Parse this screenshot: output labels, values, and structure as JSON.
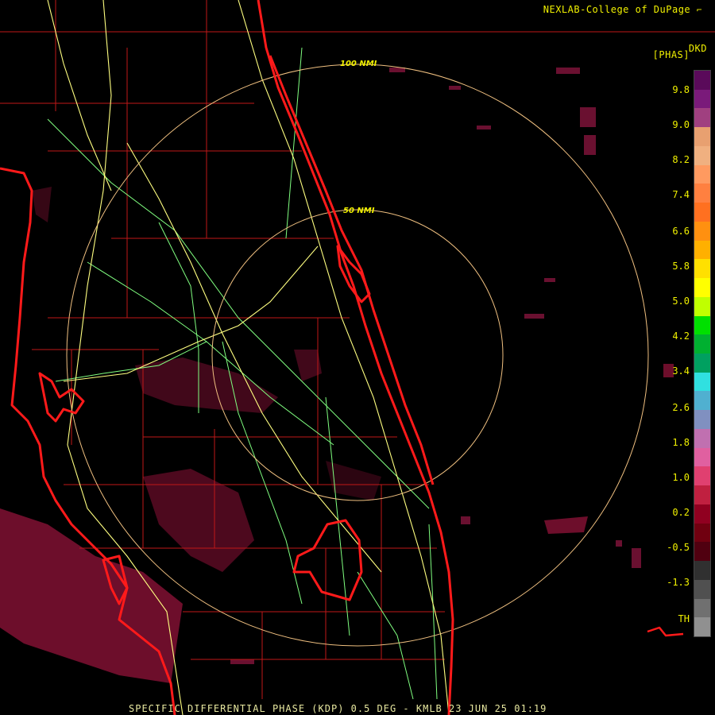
{
  "header": {
    "credit": "NEXLAB-College of DuPage",
    "credit_icon": "corner-mark-icon"
  },
  "footer": {
    "product_line": "SPECIFIC DIFFERENTIAL PHASE (KDP) 0.5 DEG - KMLB 23 JUN 25 01:19"
  },
  "map": {
    "range_rings": [
      {
        "label": "100 NMI",
        "radius_nmi": 100
      },
      {
        "label": "50 NMI",
        "radius_nmi": 50
      }
    ],
    "colors": {
      "background": "#000000",
      "coast_and_borders": "#ff1a1a",
      "county_lines": "#c01818",
      "highways": "#ffff80",
      "roads": "#80ff80",
      "range_rings": "#f0c080",
      "echo": "#7a1030"
    }
  },
  "legend": {
    "product_code": "DKD",
    "unit": "[PHAS]",
    "ticks": [
      "9.8",
      "9.0",
      "8.2",
      "7.4",
      "6.6",
      "5.8",
      "5.0",
      "4.2",
      "3.4",
      "2.6",
      "1.8",
      "1.0",
      "0.2",
      "-0.5",
      "-1.3",
      "TH"
    ],
    "colors": [
      "#5a0a5a",
      "#7a1a7a",
      "#a04080",
      "#e8a070",
      "#f0b080",
      "#ff9a60",
      "#ff8040",
      "#ff7020",
      "#ff9010",
      "#ffb000",
      "#ffe000",
      "#ffff00",
      "#c0ff00",
      "#00e000",
      "#00b030",
      "#00a060",
      "#30e0e0",
      "#50b0d0",
      "#8090c0",
      "#c070b0",
      "#e060a0",
      "#e04070",
      "#c02040",
      "#900020",
      "#700010",
      "#500010",
      "#303030",
      "#505050",
      "#707070",
      "#909090"
    ]
  }
}
